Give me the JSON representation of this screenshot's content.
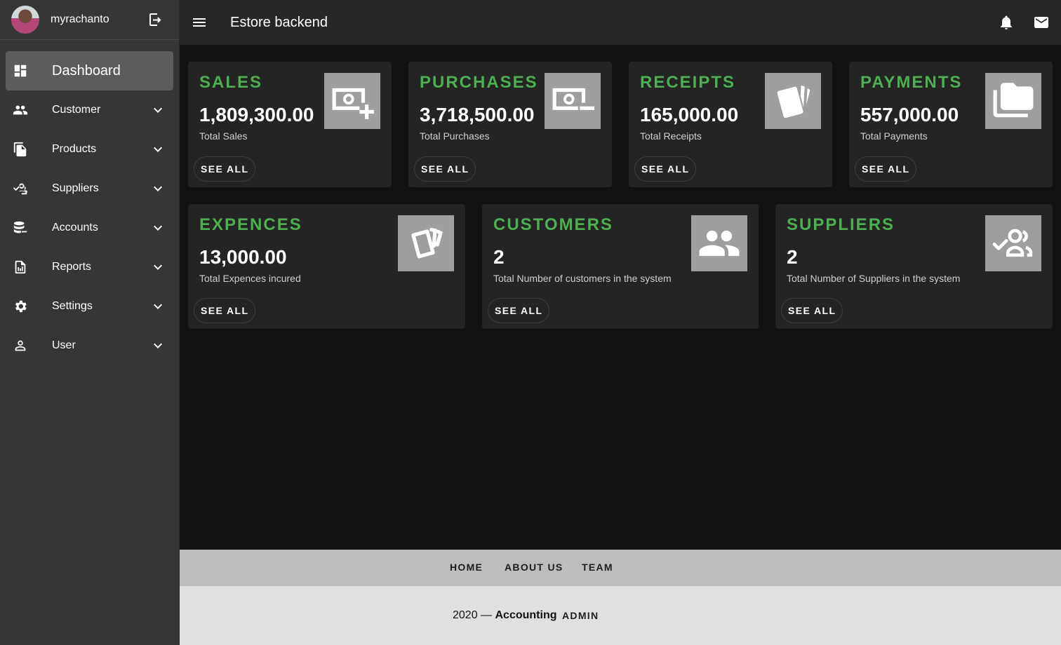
{
  "sidebar": {
    "user": {
      "name": "myrachanto",
      "avatar_icon": "avatar",
      "logout_icon": "logout-icon"
    },
    "active": {
      "label": "Dashboard",
      "icon": "dashboard-icon"
    },
    "items": [
      {
        "label": "Customer",
        "icon": "people-icon"
      },
      {
        "label": "Products",
        "icon": "file-copy-icon"
      },
      {
        "label": "Suppliers",
        "icon": "how-to-reg-icon"
      },
      {
        "label": "Accounts",
        "icon": "database-icon"
      },
      {
        "label": "Reports",
        "icon": "report-icon"
      },
      {
        "label": "Settings",
        "icon": "gear-icon"
      },
      {
        "label": "User",
        "icon": "person-icon"
      }
    ]
  },
  "header": {
    "title": "Estore backend",
    "menu_icon": "menu-icon",
    "notification_icon": "bell-icon",
    "mail_icon": "mail-icon"
  },
  "cards": {
    "sales": {
      "title": "SALES",
      "value": "1,809,300.00",
      "subtitle": "Total Sales",
      "button": "SEE ALL",
      "icon": "money-add-icon"
    },
    "purchases": {
      "title": "PURCHASES",
      "value": "3,718,500.00",
      "subtitle": "Total Purchases",
      "button": "SEE ALL",
      "icon": "money-remove-icon"
    },
    "receipts": {
      "title": "RECEIPTS",
      "value": "165,000.00",
      "subtitle": "Total Receipts",
      "button": "SEE ALL",
      "icon": "cards-icon"
    },
    "payments": {
      "title": "PAYMENTS",
      "value": "557,000.00",
      "subtitle": "Total Payments",
      "button": "SEE ALL",
      "icon": "folder-copy-icon"
    },
    "expences": {
      "title": "EXPENCES",
      "value": "13,000.00",
      "subtitle": "Total Expences incured",
      "button": "SEE ALL",
      "icon": "cards-icon"
    },
    "customers": {
      "title": "CUSTOMERS",
      "value": "2",
      "subtitle": "Total Number of customers in the system",
      "button": "SEE ALL",
      "icon": "people-icon"
    },
    "suppliers": {
      "title": "SUPPLIERS",
      "value": "2",
      "subtitle": "Total Number of Suppliers in the system",
      "button": "SEE ALL",
      "icon": "how-to-reg-icon"
    }
  },
  "footer": {
    "links": [
      "HOME",
      "ABOUT US",
      "TEAM"
    ],
    "year": "2020 —",
    "brand": "Accounting",
    "admin": "ADMIN"
  },
  "colors": {
    "accent": "#4caf50",
    "sidebar": "#363636",
    "topbar": "#272727",
    "card": "#242424",
    "background": "#121212"
  }
}
